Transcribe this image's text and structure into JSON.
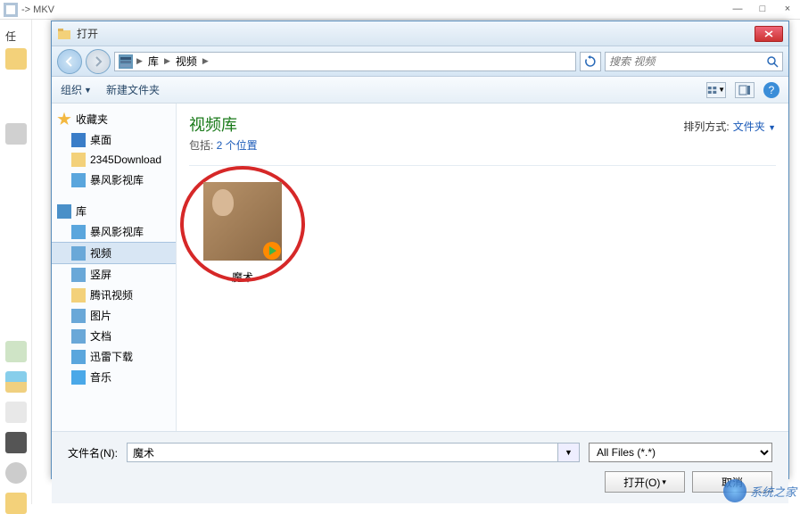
{
  "bg_app": {
    "title_arrow": "->",
    "title_format": "MKV",
    "task_label": "任",
    "min": "—",
    "max": "□",
    "close": "×"
  },
  "dialog": {
    "title": "打开",
    "close_label": "X"
  },
  "nav": {
    "crumb1": "库",
    "crumb2": "视频",
    "refresh_tip": "刷新",
    "search_placeholder": "搜索 视频"
  },
  "toolbar": {
    "organize": "组织",
    "new_folder": "新建文件夹"
  },
  "sidebar": {
    "favorites": "收藏夹",
    "fav_items": [
      "桌面",
      "2345Download",
      "暴风影视库"
    ],
    "libraries": "库",
    "lib_items": [
      "暴风影视库",
      "视频",
      "竖屏",
      "腾讯视频",
      "图片",
      "文档",
      "迅雷下载",
      "音乐"
    ]
  },
  "content": {
    "location_title": "视频库",
    "includes_prefix": "包括: ",
    "includes_link": "2 个位置",
    "sort_label": "排列方式:",
    "sort_value": "文件夹",
    "file_name": "魔术"
  },
  "bottom": {
    "filename_label": "文件名(N):",
    "filename_value": "魔术",
    "filter_value": "All Files (*.*)",
    "open_btn": "打开(O)",
    "cancel_btn": "取消"
  },
  "watermark": "系统之家"
}
